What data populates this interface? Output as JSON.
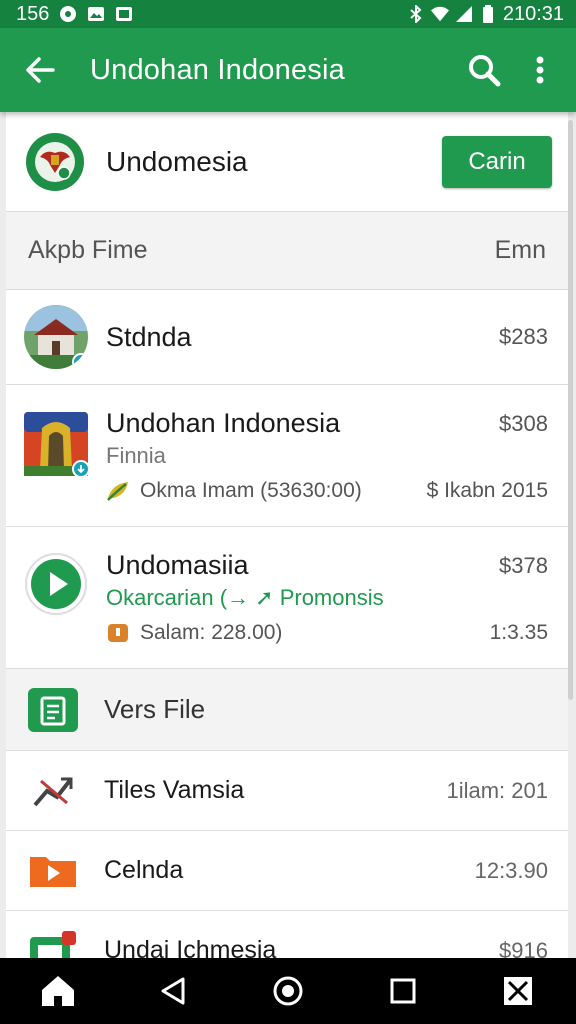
{
  "status": {
    "left": "156",
    "time": "210:31"
  },
  "app_bar": {
    "title": "Undohan Indonesia"
  },
  "header": {
    "name": "Undomesia",
    "button_label": "Carin"
  },
  "section1": {
    "left": "Akpb Fime",
    "right": "Emn"
  },
  "items": [
    {
      "title": "Stdnda",
      "price": "$283"
    },
    {
      "title": "Undohan Indonesia",
      "subtitle": "Finnia",
      "price": "$308",
      "meta_left": "Okma Imam (53630:00)",
      "meta_right": "$ Ikabn 2015"
    },
    {
      "title": "Undomasiia",
      "subtitle": "Okarcarian (→ ➚ Promonsis",
      "price": "$378",
      "meta_left": "Salam: 228.00)",
      "meta_right": "1:3.35"
    }
  ],
  "section2": {
    "title": "Vers File"
  },
  "files": [
    {
      "title": "Tiles Vamsia",
      "right": "1ilam: 201"
    },
    {
      "title": "Celnda",
      "right": "12:3.90"
    },
    {
      "title": "Undai Ichmesia",
      "right": "$916"
    }
  ],
  "colors": {
    "primary": "#1f9a4e",
    "status_bar": "#16823f",
    "accent_badge": "#1aa0b8"
  },
  "icons": {
    "back": "arrow-left-icon",
    "search": "search-icon",
    "more": "more-vert-icon",
    "play": "play-icon",
    "doc": "document-icon",
    "chart": "chart-icon",
    "folder": "folder-icon",
    "home": "home-icon",
    "back_nav": "back-triangle-icon",
    "recents": "square-icon",
    "overview": "circle-icon"
  }
}
